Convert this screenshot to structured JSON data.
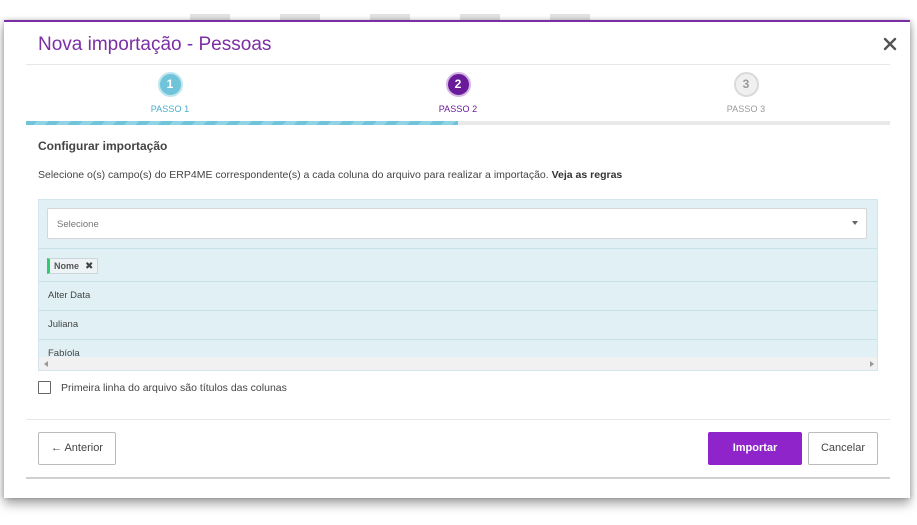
{
  "modal": {
    "title": "Nova importação - Pessoas"
  },
  "stepper": {
    "steps": [
      {
        "number": "1",
        "label": "PASSO 1",
        "state": "done"
      },
      {
        "number": "2",
        "label": "PASSO 2",
        "state": "active"
      },
      {
        "number": "3",
        "label": "PASSO 3",
        "state": "pending"
      }
    ],
    "progress_percent": 50
  },
  "content": {
    "section_title": "Configurar importação",
    "description": "Selecione o(s) campo(s) do ERP4ME correspondente(s) a cada coluna do arquivo para realizar a importação.",
    "rules_link": "Veja as regras"
  },
  "mapping": {
    "select_placeholder": "Selecione",
    "selected_tag": "Nome",
    "rows": [
      "Alter Data",
      "Juliana",
      "Fabíola"
    ]
  },
  "options": {
    "first_line_titles_label": "Primeira linha do arquivo são títulos das colunas",
    "first_line_titles_checked": false
  },
  "footer": {
    "prev_label": "Anterior",
    "import_label": "Importar",
    "cancel_label": "Cancelar"
  },
  "colors": {
    "accent": "#7b2fa5",
    "primary_button": "#8e24c9",
    "step_done": "#6fc4da",
    "step_active": "#6a1b9a",
    "tag_marker": "#2ecc71"
  }
}
